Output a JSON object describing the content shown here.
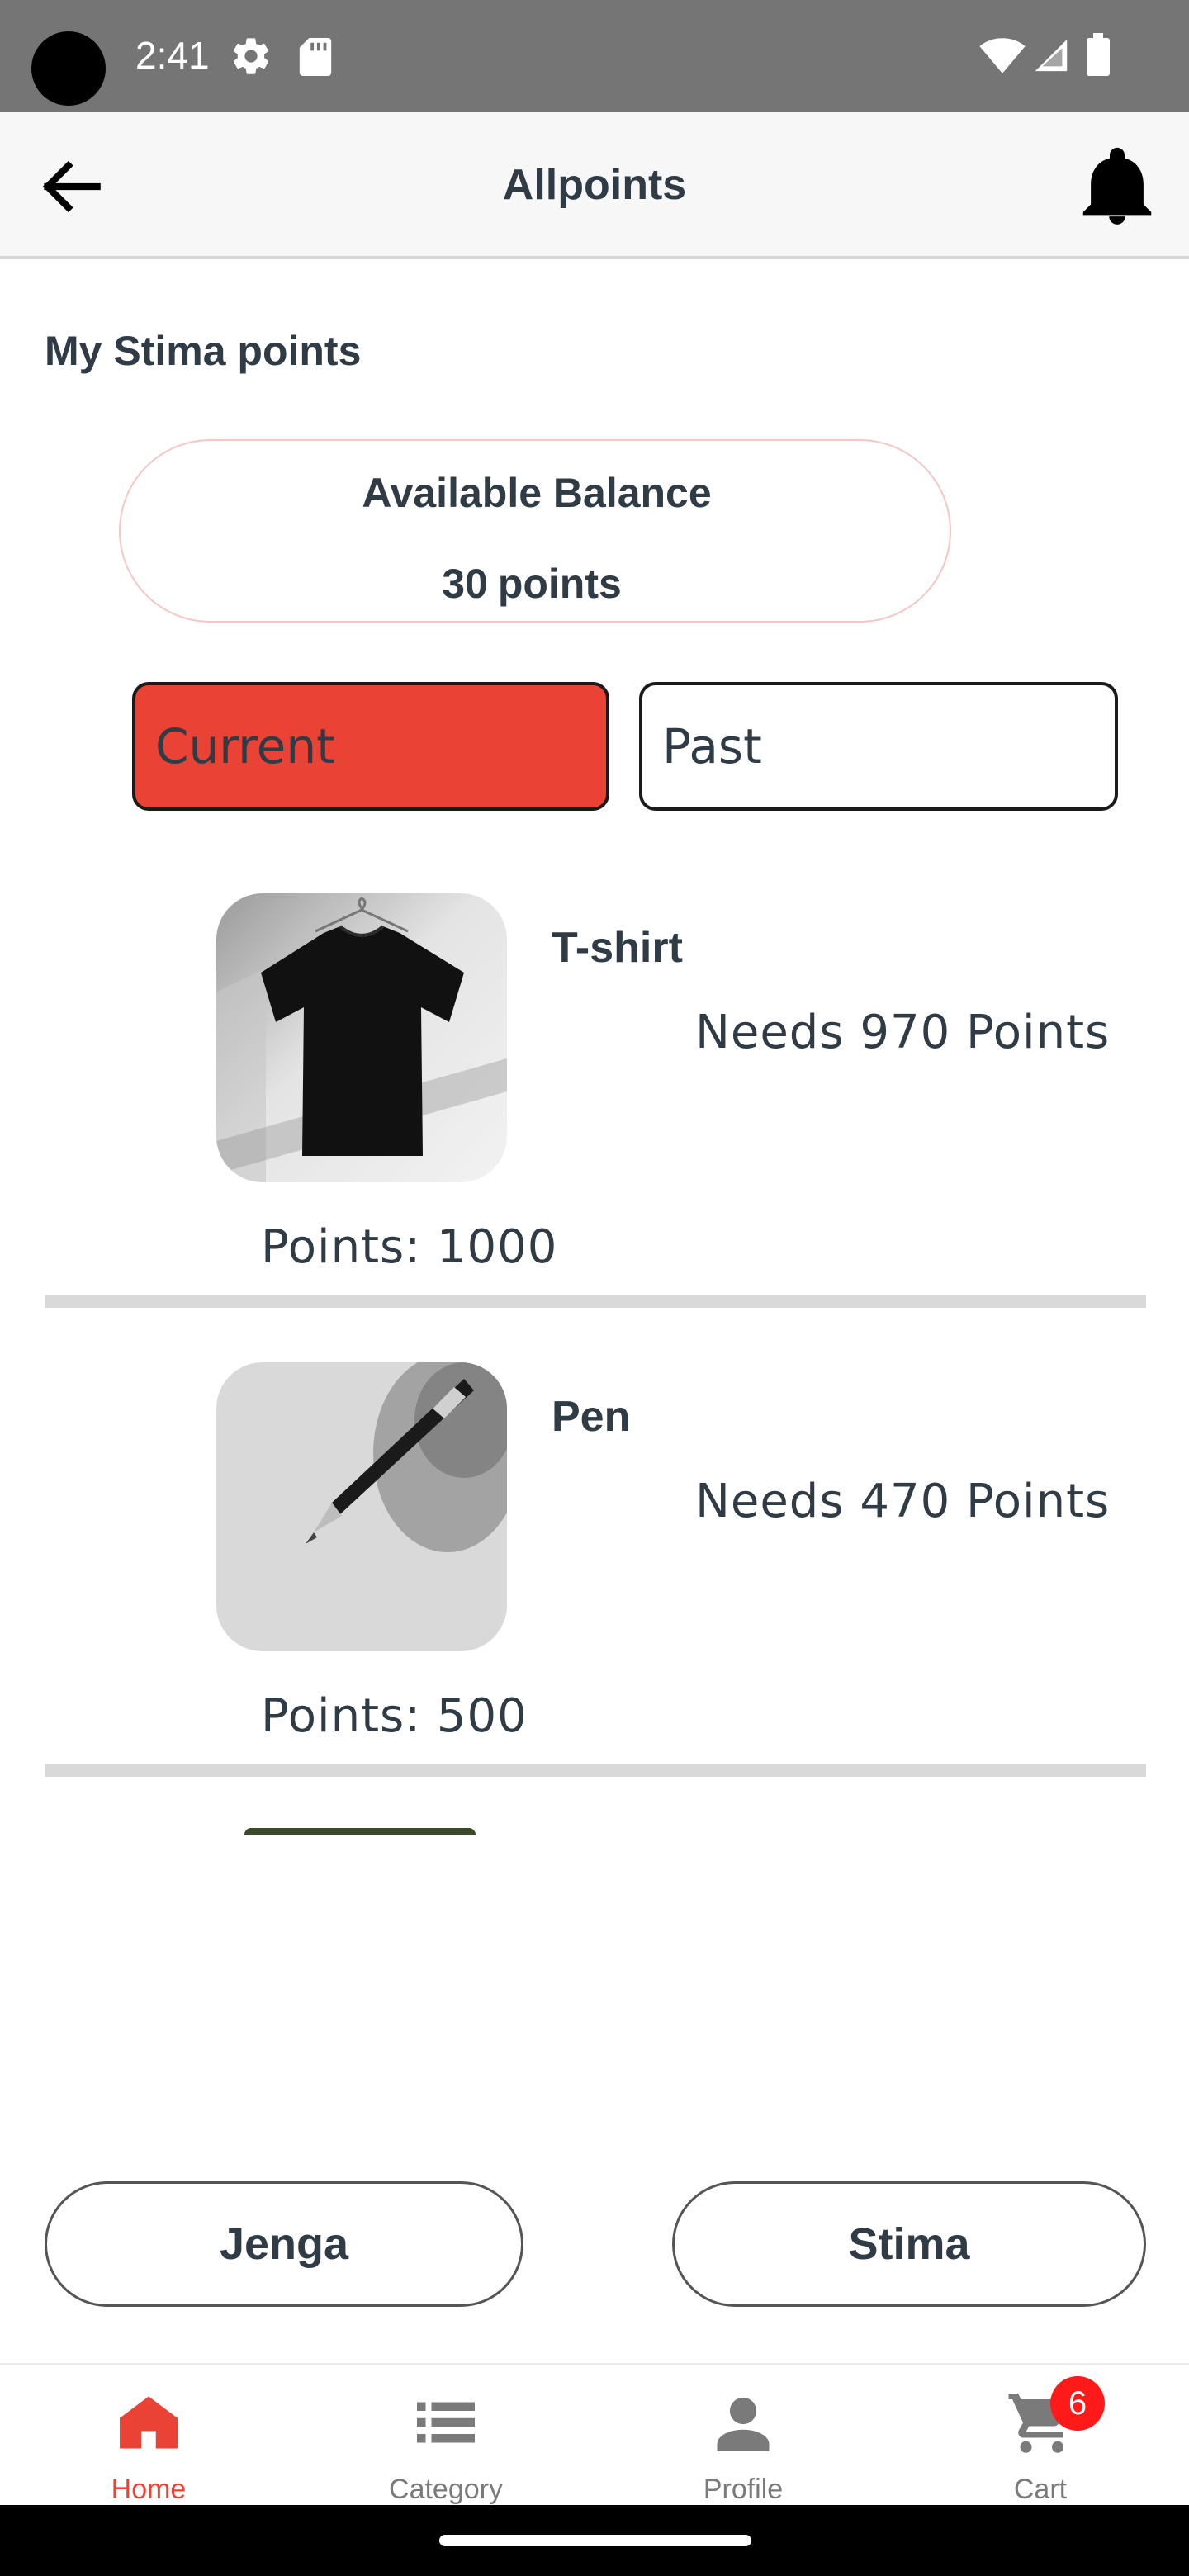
{
  "status_bar": {
    "time": "2:41",
    "icons": [
      "settings-gear-icon",
      "sd-card-icon",
      "wifi-icon",
      "cell-signal-icon",
      "battery-icon"
    ]
  },
  "app_bar": {
    "title": "Allpoints",
    "back_icon": "arrow-back-icon",
    "notification_icon": "bell-icon"
  },
  "section_title": "My Stima points",
  "balance": {
    "label": "Available Balance",
    "amount": "30",
    "unit": "points"
  },
  "tabs": {
    "current": "Current",
    "past": "Past",
    "active": "current"
  },
  "items": [
    {
      "name": "T-shirt",
      "needs": "Needs 970 Points",
      "points": "Points: 1000"
    },
    {
      "name": "Pen",
      "needs": "Needs 470 Points",
      "points": "Points: 500"
    }
  ],
  "actions": {
    "jenga": "Jenga",
    "stima": "Stima"
  },
  "bottom_nav": {
    "items": [
      {
        "label": "Home",
        "icon": "home-icon",
        "active": true
      },
      {
        "label": "Category",
        "icon": "list-icon",
        "active": false
      },
      {
        "label": "Profile",
        "icon": "person-icon",
        "active": false
      },
      {
        "label": "Cart",
        "icon": "cart-icon",
        "active": false
      }
    ],
    "cart_count": "6"
  },
  "colors": {
    "accent": "#ea4335",
    "text": "#2f3b45",
    "status_bar": "#757575",
    "divider": "#d9d9d9",
    "badge": "#ff1a1a"
  }
}
